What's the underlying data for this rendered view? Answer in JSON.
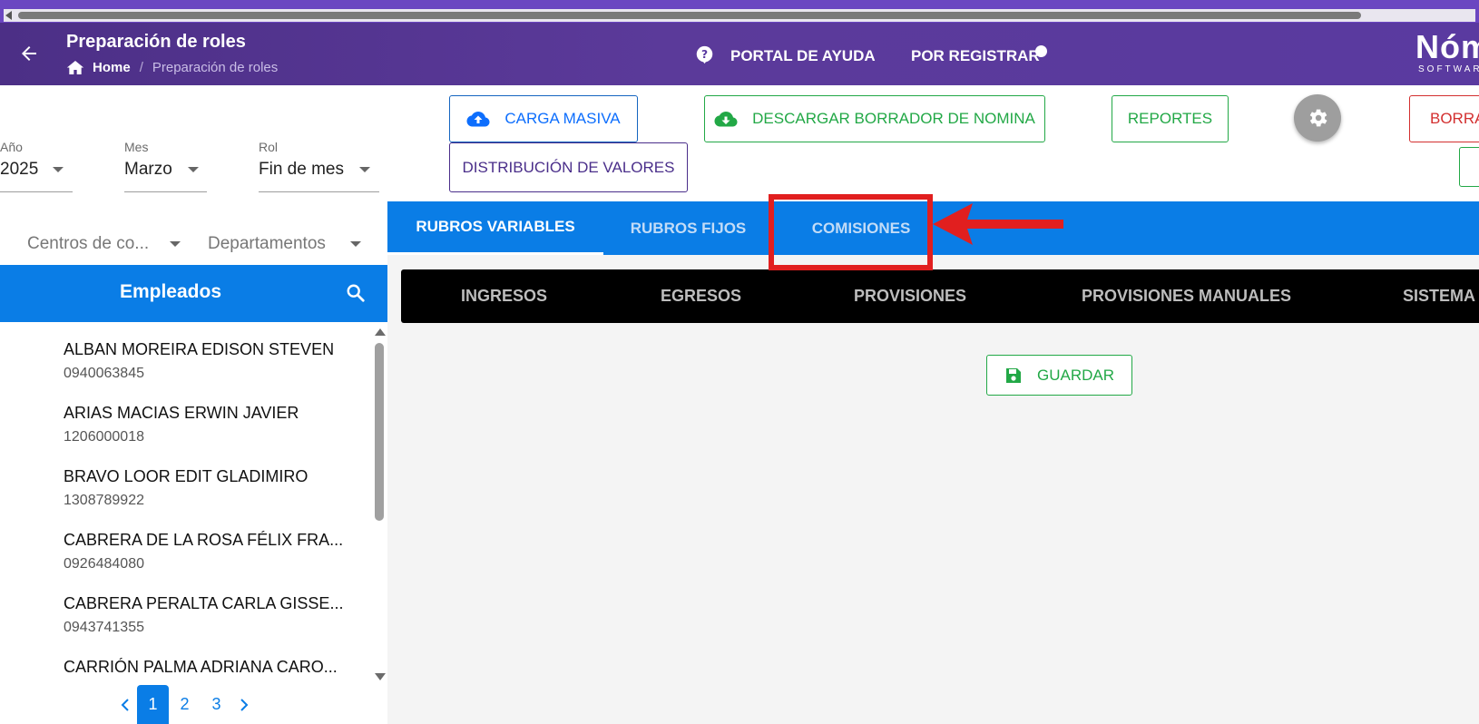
{
  "header": {
    "title": "Preparación de roles",
    "breadcrumb_home": "Home",
    "breadcrumb_separator": "/",
    "breadcrumb_current": "Preparación de roles",
    "help_portal_label": "PORTAL DE AYUDA",
    "register_label": "POR REGISTRAR",
    "logo_text": "Nóm",
    "logo_subtext": "SOFTWARE"
  },
  "filters": {
    "year": {
      "label": "Año",
      "value": "2025"
    },
    "month": {
      "label": "Mes",
      "value": "Marzo"
    },
    "role": {
      "label": "Rol",
      "value": "Fin de mes"
    },
    "cost_centers": {
      "placeholder": "Centros de co..."
    },
    "departments": {
      "placeholder": "Departamentos"
    }
  },
  "toolbar": {
    "bulk_upload_label": "CARGA MASIVA",
    "download_draft_label": "DESCARGAR BORRADOR DE NOMINA",
    "reports_label": "REPORTES",
    "delete_label": "BORRA",
    "distribution_label": "DISTRIBUCIÓN DE VALORES"
  },
  "employees": {
    "title": "Empleados",
    "items": [
      {
        "name": "ALBAN MOREIRA EDISON STEVEN",
        "id": "0940063845"
      },
      {
        "name": "ARIAS MACIAS ERWIN JAVIER",
        "id": "1206000018"
      },
      {
        "name": "BRAVO LOOR EDIT GLADIMIRO",
        "id": "1308789922"
      },
      {
        "name": "CABRERA DE LA ROSA FÉLIX FRA...",
        "id": "0926484080"
      },
      {
        "name": "CABRERA PERALTA CARLA GISSE...",
        "id": "0943741355"
      },
      {
        "name": "CARRIÓN PALMA ADRIANA CARO...",
        "id": ""
      }
    ],
    "pagination": {
      "pages": [
        "1",
        "2",
        "3"
      ],
      "current": "1"
    }
  },
  "tabs": [
    "RUBROS VARIABLES",
    "RUBROS FIJOS",
    "COMISIONES"
  ],
  "subtabs": [
    "INGRESOS",
    "EGRESOS",
    "PROVISIONES",
    "PROVISIONES MANUALES",
    "SISTEMA"
  ],
  "main": {
    "save_label": "GUARDAR"
  },
  "colors": {
    "header_purple": "#5a3aa0",
    "primary_blue": "#0a7de6",
    "success_green": "#22a846",
    "danger_red": "#d32f2f",
    "annotation_red": "#e11f1f"
  },
  "icons": [
    "arrow-left-icon",
    "home-icon",
    "help-circle-icon",
    "cloud-upload-icon",
    "cloud-download-icon",
    "gear-icon",
    "search-icon",
    "chevron-left-icon",
    "chevron-right-icon",
    "save-icon",
    "caret-down-icon"
  ]
}
